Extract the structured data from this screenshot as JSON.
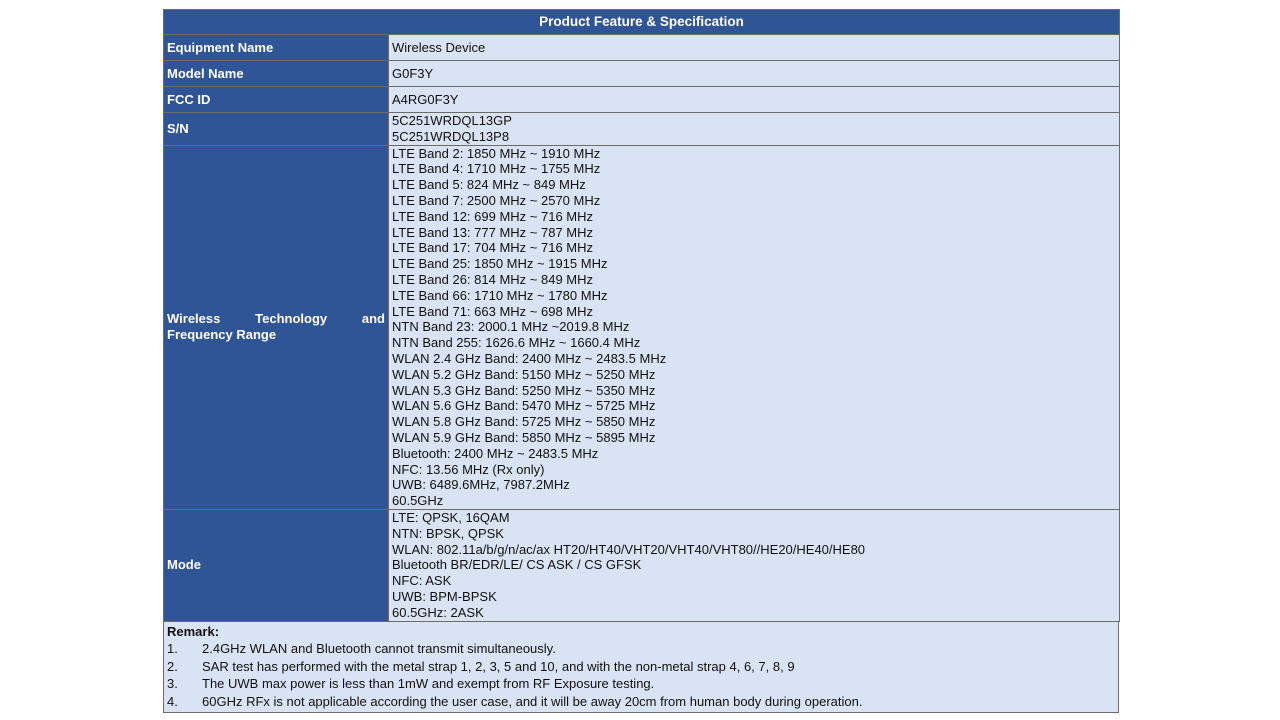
{
  "table": {
    "title": "Product Feature & Specification",
    "rows": [
      {
        "label": "Equipment Name",
        "lines": [
          "Wireless Device"
        ]
      },
      {
        "label": "Model Name",
        "lines": [
          "G0F3Y"
        ]
      },
      {
        "label": "FCC ID",
        "lines": [
          "A4RG0F3Y"
        ]
      },
      {
        "label": "S/N",
        "lines": [
          "5C251WRDQL13GP",
          "5C251WRDQL13P8"
        ]
      },
      {
        "label_line1": "Wireless Technology and",
        "label_line2": "Frequency Range",
        "lines": [
          "LTE Band 2: 1850 MHz ~ 1910 MHz",
          "LTE Band 4: 1710 MHz ~ 1755 MHz",
          "LTE Band 5: 824 MHz ~ 849 MHz",
          "LTE Band 7: 2500 MHz ~ 2570 MHz",
          "LTE Band 12: 699 MHz ~ 716 MHz",
          "LTE Band 13: 777 MHz ~ 787 MHz",
          "LTE Band 17: 704 MHz ~ 716 MHz",
          "LTE Band 25: 1850 MHz ~ 1915 MHz",
          "LTE Band 26: 814 MHz ~ 849 MHz",
          "LTE Band 66: 1710 MHz ~ 1780 MHz",
          "LTE Band 71: 663 MHz ~ 698 MHz",
          "NTN Band 23: 2000.1 MHz ~2019.8 MHz",
          "NTN Band 255: 1626.6 MHz ~ 1660.4 MHz",
          "WLAN 2.4 GHz Band: 2400 MHz ~ 2483.5 MHz",
          "WLAN 5.2 GHz Band: 5150 MHz ~ 5250 MHz",
          "WLAN 5.3 GHz Band: 5250 MHz ~ 5350 MHz",
          "WLAN 5.6 GHz Band: 5470 MHz ~ 5725 MHz",
          "WLAN 5.8 GHz Band: 5725 MHz ~ 5850 MHz",
          "WLAN 5.9 GHz Band: 5850 MHz ~ 5895 MHz",
          "Bluetooth: 2400 MHz ~ 2483.5 MHz",
          "NFC: 13.56 MHz (Rx only)",
          "UWB: 6489.6MHz, 7987.2MHz",
          "60.5GHz"
        ]
      },
      {
        "label": "Mode",
        "lines": [
          "LTE: QPSK, 16QAM",
          "NTN: BPSK, QPSK",
          "WLAN: 802.11a/b/g/n/ac/ax HT20/HT40/VHT20/VHT40/VHT80//HE20/HE40/HE80",
          "Bluetooth BR/EDR/LE/ CS ASK / CS GFSK",
          "NFC: ASK",
          "UWB: BPM-BPSK",
          "60.5GHz: 2ASK"
        ]
      }
    ]
  },
  "remark": {
    "title": "Remark:",
    "items": [
      {
        "num": "1.",
        "text": "2.4GHz WLAN and Bluetooth cannot transmit simultaneously."
      },
      {
        "num": "2.",
        "text": "SAR test has performed with the metal strap 1, 2, 3, 5 and 10, and with the non-metal strap 4, 6, 7, 8, 9"
      },
      {
        "num": "3.",
        "text": "The UWB max power is less than 1mW and exempt from RF Exposure testing."
      },
      {
        "num": "4.",
        "text": "60GHz RFx is not applicable according the user case, and it will be away 20cm from human body during operation."
      }
    ]
  },
  "colors": {
    "header_bg": "#2f5597",
    "value_bg": "#dae3f3"
  }
}
